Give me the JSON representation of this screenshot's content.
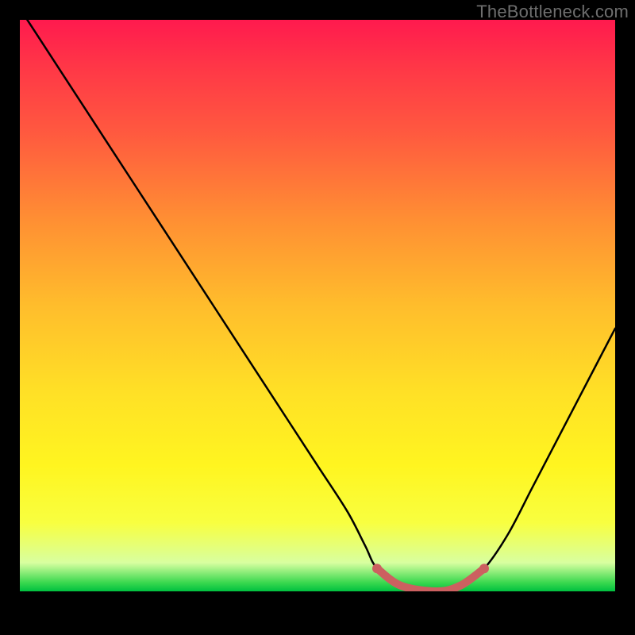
{
  "watermark": "TheBottleneck.com",
  "chart_data": {
    "type": "line",
    "title": "",
    "xlabel": "",
    "ylabel": "",
    "xlim": [
      0,
      100
    ],
    "ylim": [
      0,
      100
    ],
    "grid": false,
    "legend": false,
    "series": [
      {
        "name": "curve",
        "x": [
          0,
          5,
          10,
          15,
          20,
          25,
          30,
          35,
          40,
          45,
          50,
          55,
          58,
          60,
          64,
          70,
          74,
          78,
          82,
          86,
          90,
          94,
          100
        ],
        "values": [
          102,
          94,
          86,
          78,
          70,
          62,
          54,
          46,
          38,
          30,
          22,
          14,
          8,
          4,
          1,
          0,
          1,
          4,
          10,
          18,
          26,
          34,
          46
        ],
        "color": "#000000"
      },
      {
        "name": "highlight-segment",
        "x": [
          60,
          64,
          70,
          74,
          78
        ],
        "values": [
          4,
          1,
          0,
          1,
          4
        ],
        "color": "#cc6060"
      }
    ],
    "background_gradient": {
      "direction": "vertical",
      "stops": [
        {
          "pos": 0,
          "color": "#ff1a4e"
        },
        {
          "pos": 0.2,
          "color": "#ff5a3f"
        },
        {
          "pos": 0.5,
          "color": "#ffbd2c"
        },
        {
          "pos": 0.8,
          "color": "#fff520"
        },
        {
          "pos": 0.97,
          "color": "#a0ff80"
        },
        {
          "pos": 1.0,
          "color": "#00c040"
        }
      ]
    }
  }
}
